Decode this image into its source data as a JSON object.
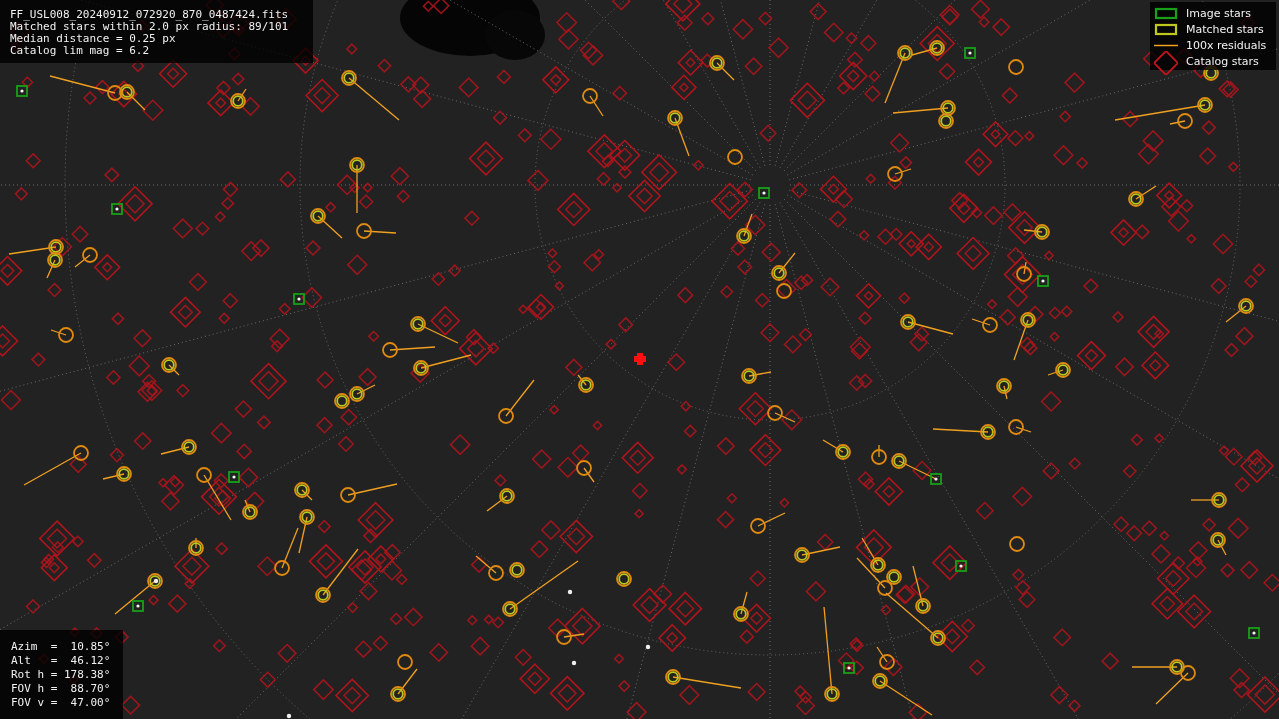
{
  "info_panel": {
    "lines": [
      "FF_USL008_20240912_072920_870_0487424.fits",
      "Matched stars within 2.0 px radius: 89/101",
      "Median distance = 0.25 px",
      "Catalog lim mag = 6.2"
    ]
  },
  "legend": {
    "items": [
      {
        "kind": "image",
        "label": "Image stars"
      },
      {
        "kind": "matched",
        "label": "Matched stars"
      },
      {
        "kind": "residual",
        "label": "100x residuals"
      },
      {
        "kind": "catalog",
        "label": "Catalog stars"
      }
    ]
  },
  "pointing_panel": {
    "lines": [
      "Azim  =  10.85°",
      "Alt   =  46.12°",
      "Rot h = 178.38°",
      "FOV h =  88.70°",
      "FOV v =  47.00°"
    ]
  }
}
